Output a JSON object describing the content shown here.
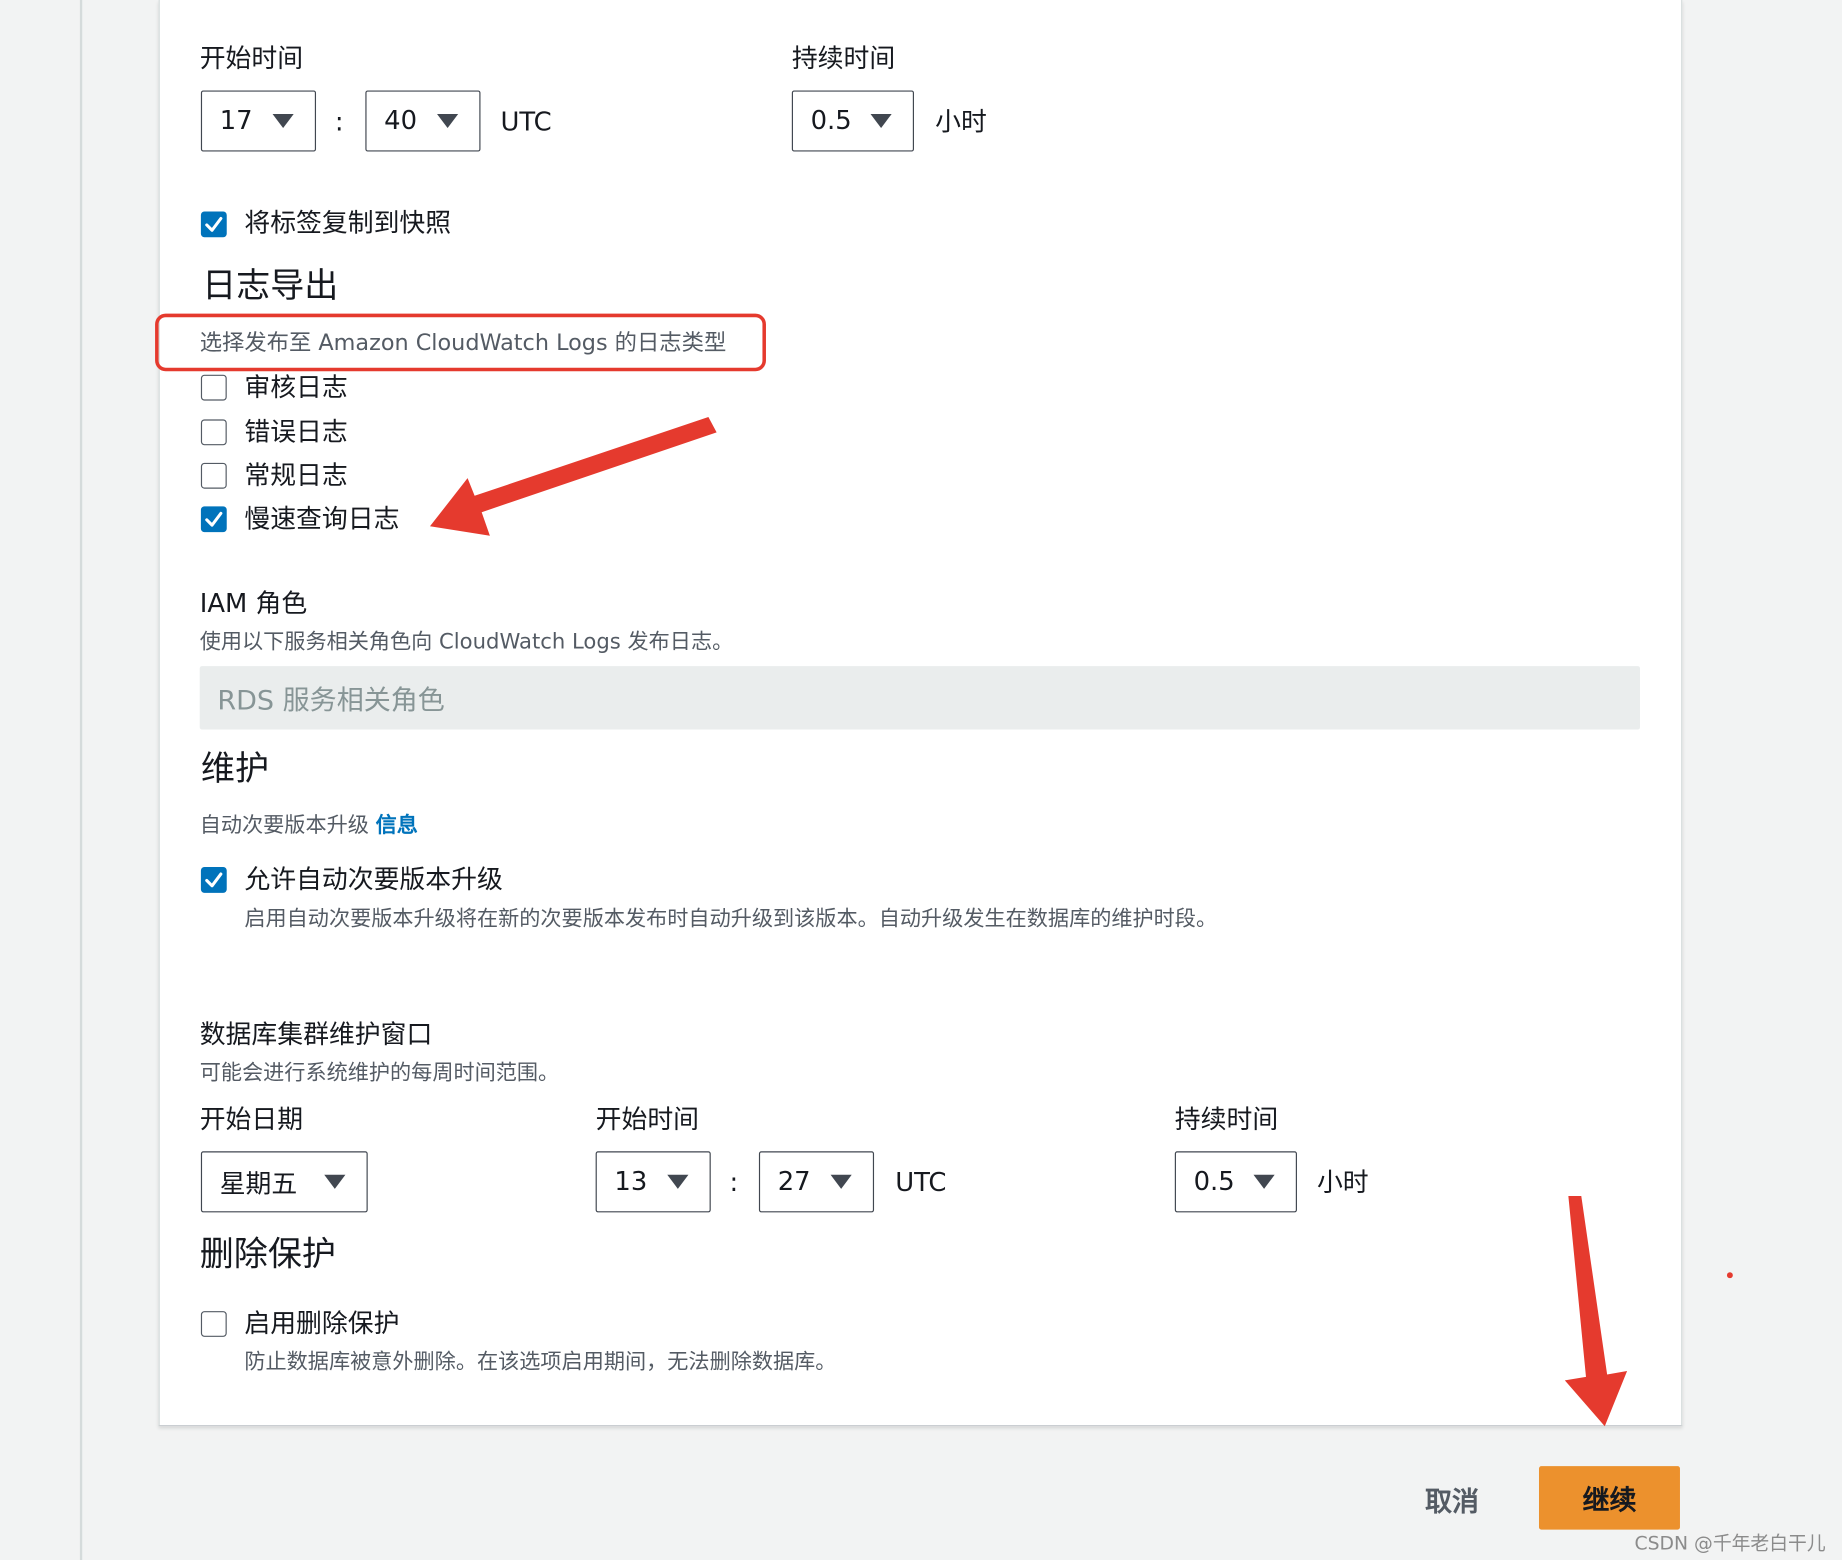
{
  "backup_window": {
    "start_time_label": "开始时间",
    "hour": "17",
    "separator": ":",
    "minute": "40",
    "timezone": "UTC",
    "duration_label": "持续时间",
    "duration": "0.5",
    "duration_unit": "小时"
  },
  "copy_tags": {
    "label": "将标签复制到快照",
    "checked": true
  },
  "log_export": {
    "heading": "日志导出",
    "description": "选择发布至 Amazon CloudWatch Logs 的日志类型",
    "options": [
      {
        "label": "审核日志",
        "checked": false
      },
      {
        "label": "错误日志",
        "checked": false
      },
      {
        "label": "常规日志",
        "checked": false
      },
      {
        "label": "慢速查询日志",
        "checked": true
      }
    ]
  },
  "iam_role": {
    "label": "IAM 角色",
    "description": "使用以下服务相关角色向 CloudWatch Logs 发布日志。",
    "value": "RDS 服务相关角色"
  },
  "maintenance": {
    "heading": "维护",
    "auto_upgrade_label": "自动次要版本升级",
    "info_link": "信息",
    "auto_upgrade_checkbox_label": "允许自动次要版本升级",
    "auto_upgrade_checked": true,
    "auto_upgrade_description": "启用自动次要版本升级将在新的次要版本发布时自动升级到该版本。自动升级发生在数据库的维护时段。"
  },
  "maintenance_window": {
    "title": "数据库集群维护窗口",
    "description": "可能会进行系统维护的每周时间范围。",
    "start_day_label": "开始日期",
    "start_day": "星期五",
    "start_time_label": "开始时间",
    "hour": "13",
    "separator": ":",
    "minute": "27",
    "timezone": "UTC",
    "duration_label": "持续时间",
    "duration": "0.5",
    "duration_unit": "小时"
  },
  "deletion_protection": {
    "heading": "删除保护",
    "checkbox_label": "启用删除保护",
    "checked": false,
    "description": "防止数据库被意外删除。在该选项启用期间，无法删除数据库。"
  },
  "actions": {
    "cancel": "取消",
    "continue": "继续"
  },
  "watermark": "CSDN @千年老白干儿",
  "colors": {
    "primary_button": "#ec912d",
    "checkbox_checked": "#0073bb",
    "annotation": "#e53a2e",
    "link": "#0073bb"
  },
  "annotations": [
    {
      "type": "highlight-box",
      "target": "log-export-description"
    },
    {
      "type": "arrow",
      "target": "slow-query-log-checkbox"
    },
    {
      "type": "arrow",
      "target": "continue-button"
    }
  ]
}
